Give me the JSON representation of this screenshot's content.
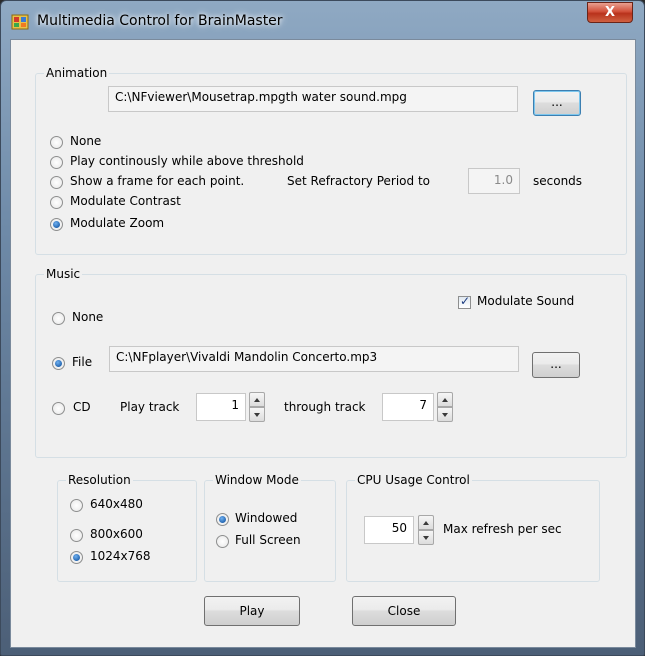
{
  "window": {
    "title": "Multimedia Control for BrainMaster",
    "close_glyph": "X"
  },
  "animation": {
    "group_label": "Animation",
    "file_path": "C:\\NFviewer\\Mousetrap.mpgth water sound.mpg",
    "browse_label": "...",
    "options": [
      {
        "label": "None",
        "checked": false
      },
      {
        "label": "Play continously while above threshold",
        "checked": false
      },
      {
        "label": "Show a frame for each point.",
        "checked": false
      },
      {
        "label": "Modulate Contrast",
        "checked": false
      },
      {
        "label": "Modulate Zoom",
        "checked": true
      }
    ],
    "refractory_label": "Set Refractory Period to",
    "refractory_value": "1.0",
    "refractory_units": "seconds"
  },
  "music": {
    "group_label": "Music",
    "modulate_sound_label": "Modulate Sound",
    "modulate_sound_checked": true,
    "none_label": "None",
    "file_label": "File",
    "file_path": "C:\\NFplayer\\Vivaldi Mandolin Concerto.mp3",
    "browse_label": "...",
    "cd_label": "CD",
    "play_track_label": "Play track",
    "start_track": "1",
    "through_track_label": "through track",
    "end_track": "7",
    "selected": "File"
  },
  "resolution": {
    "group_label": "Resolution",
    "options": [
      {
        "label": "640x480",
        "checked": false
      },
      {
        "label": "800x600",
        "checked": false
      },
      {
        "label": "1024x768",
        "checked": true
      }
    ]
  },
  "window_mode": {
    "group_label": "Window Mode",
    "options": [
      {
        "label": "Windowed",
        "checked": true
      },
      {
        "label": "Full Screen",
        "checked": false
      }
    ]
  },
  "cpu": {
    "group_label": "CPU Usage Control",
    "value": "50",
    "units_label": "Max refresh per sec"
  },
  "buttons": {
    "play_label": "Play",
    "close_label": "Close"
  }
}
